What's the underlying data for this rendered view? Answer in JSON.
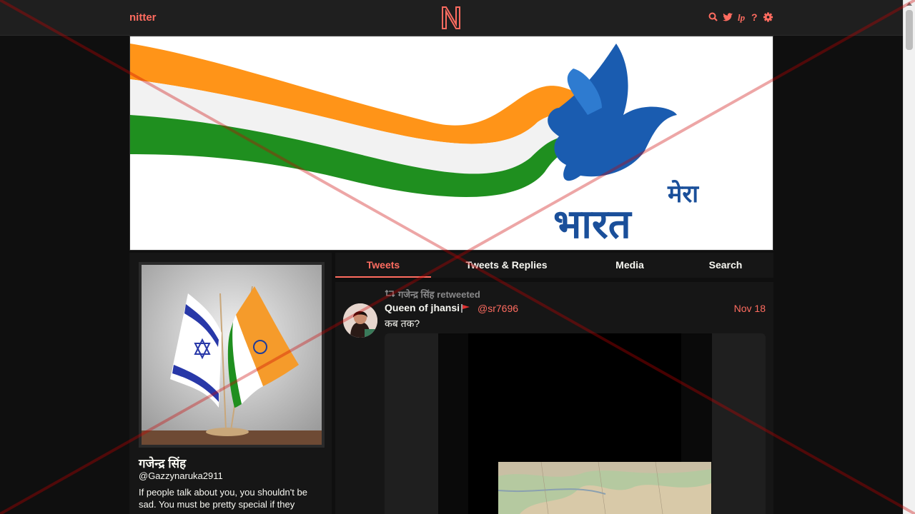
{
  "navbar": {
    "brand": "nitter",
    "icons": [
      "search-icon",
      "twitter-bird-icon",
      "rss-icon",
      "help-icon",
      "settings-gear-icon"
    ]
  },
  "banner": {
    "hindi_text_line1": "मेरा",
    "hindi_text_line2": "भारत"
  },
  "profile": {
    "fullname": "गजेन्द्र सिंह",
    "username": "@Gazzynaruka2911",
    "bio": "If people talk about you, you shouldn't be sad. You must be pretty special if they"
  },
  "tabs": [
    {
      "label": "Tweets",
      "active": true
    },
    {
      "label": "Tweets & Replies",
      "active": false
    },
    {
      "label": "Media",
      "active": false
    },
    {
      "label": "Search",
      "active": false
    }
  ],
  "tweet": {
    "retweet_header": "गजेन्द्र सिंह retweeted",
    "fullname": "Queen of jhansi",
    "username": "@sr7696",
    "date": "Nov 18",
    "content": "कब तक?"
  },
  "colors": {
    "accent": "#ff6c60",
    "background": "#0f0f0f",
    "panel": "#161616",
    "navbar": "#1f1f1f",
    "muted": "#888889",
    "overlay": "#cc0000"
  }
}
